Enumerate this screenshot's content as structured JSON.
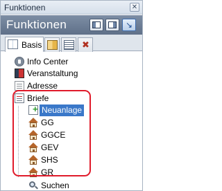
{
  "window": {
    "title": "Funktionen",
    "close_icon": "close-icon"
  },
  "header": {
    "title": "Funktionen",
    "buttons": [
      {
        "icon": "panel-left-icon"
      },
      {
        "icon": "panel-right-icon"
      },
      {
        "icon": "pin-down-icon"
      }
    ]
  },
  "tabs": [
    {
      "label": "Basis",
      "icon": "book-icon",
      "active": true
    },
    {
      "label": "",
      "icon": "folder-book-icon",
      "active": false
    },
    {
      "label": "",
      "icon": "list-icon",
      "active": false
    },
    {
      "label": "",
      "icon": "tools-icon",
      "active": false
    }
  ],
  "tree": {
    "items": [
      {
        "label": "Info Center",
        "icon": "info-icon"
      },
      {
        "label": "Veranstaltung",
        "icon": "event-icon"
      },
      {
        "label": "Adresse",
        "icon": "address-icon"
      },
      {
        "label": "Briefe",
        "icon": "letters-icon"
      }
    ],
    "briefe_children": [
      {
        "label": "Neuanlage",
        "icon": "new-document-icon",
        "selected": true
      },
      {
        "label": "GG",
        "icon": "house-icon"
      },
      {
        "label": "GGCE",
        "icon": "house-icon"
      },
      {
        "label": "GEV",
        "icon": "house-icon"
      },
      {
        "label": "SHS",
        "icon": "house-icon"
      },
      {
        "label": "GR",
        "icon": "house-icon"
      }
    ],
    "search": {
      "label": "Suchen",
      "icon": "search-icon"
    }
  },
  "colors": {
    "highlight": "#e01a2a",
    "selection": "#3a78c9",
    "header": "#6b7c94"
  }
}
